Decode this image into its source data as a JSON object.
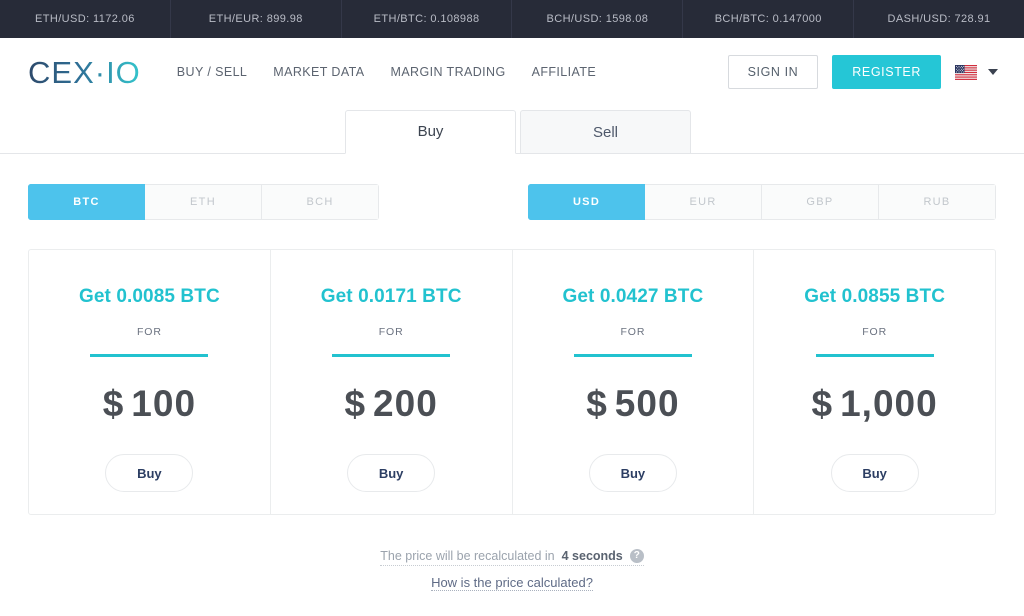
{
  "ticker": {
    "items": [
      {
        "label": "ETH/USD: 1172.06"
      },
      {
        "label": "ETH/EUR: 899.98"
      },
      {
        "label": "ETH/BTC: 0.108988"
      },
      {
        "label": "BCH/USD: 1598.08"
      },
      {
        "label": "BCH/BTC: 0.147000"
      },
      {
        "label": "DASH/USD: 728.91"
      }
    ]
  },
  "header": {
    "logo": "CEX·IO",
    "nav": [
      {
        "label": "BUY / SELL"
      },
      {
        "label": "MARKET DATA"
      },
      {
        "label": "MARGIN TRADING"
      },
      {
        "label": "AFFILIATE"
      }
    ],
    "sign_in_label": "SIGN IN",
    "register_label": "REGISTER",
    "language_flag": "us-flag-icon",
    "language_caret": "chevron-down-icon"
  },
  "tabs": [
    {
      "label": "Buy",
      "active": true
    },
    {
      "label": "Sell",
      "active": false
    }
  ],
  "crypto_selector": {
    "options": [
      {
        "label": "BTC",
        "active": true
      },
      {
        "label": "ETH",
        "active": false
      },
      {
        "label": "BCH",
        "active": false
      }
    ]
  },
  "fiat_selector": {
    "options": [
      {
        "label": "USD",
        "active": true
      },
      {
        "label": "EUR",
        "active": false
      },
      {
        "label": "GBP",
        "active": false
      },
      {
        "label": "RUB",
        "active": false
      }
    ]
  },
  "cards": [
    {
      "get": "Get 0.0085 BTC",
      "for": "FOR",
      "currency": "$",
      "amount": "100",
      "buy_label": "Buy"
    },
    {
      "get": "Get 0.0171 BTC",
      "for": "FOR",
      "currency": "$",
      "amount": "200",
      "buy_label": "Buy"
    },
    {
      "get": "Get 0.0427 BTC",
      "for": "FOR",
      "currency": "$",
      "amount": "500",
      "buy_label": "Buy"
    },
    {
      "get": "Get 0.0855 BTC",
      "for": "FOR",
      "currency": "$",
      "amount": "1,000",
      "buy_label": "Buy"
    }
  ],
  "footer": {
    "recalc_prefix": "The price will be recalculated in",
    "recalc_time": "4 seconds",
    "help_icon_glyph": "?",
    "price_link": "How is the price calculated?"
  },
  "colors": {
    "ticker_bg": "#272b38",
    "accent_teal": "#22c2cf",
    "accent_blue": "#4dc3ec",
    "register_bg": "#25c6d6",
    "price_text": "#4b4f55"
  }
}
